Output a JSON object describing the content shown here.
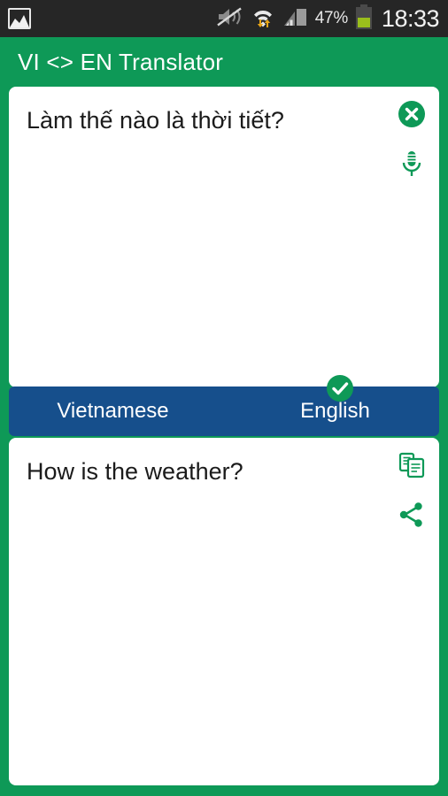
{
  "statusbar": {
    "notification_icon": "gallery-icon",
    "sound_icon": "mute-vibrate-icon",
    "wifi_icon": "wifi-transfer-icon",
    "signal_icon": "cellular-signal-icon",
    "battery_percent": "47%",
    "battery_icon": "battery-icon",
    "time": "18:33",
    "bg_color": "#262626"
  },
  "appbar": {
    "title": "VI <> EN Translator",
    "bg_color": "#0E9957"
  },
  "source_card": {
    "text": "Làm thế nào là thời tiết?",
    "clear_icon": "clear-circle-icon",
    "mic_icon": "microphone-icon"
  },
  "language_bar": {
    "source_language": "Vietnamese",
    "target_language": "English",
    "selected": "English",
    "check_icon": "check-circle-icon",
    "bg_color": "#164F8C"
  },
  "target_card": {
    "text": "How is the weather?",
    "copy_icon": "copy-icon",
    "share_icon": "share-icon"
  },
  "theme": {
    "green": "#0E9957",
    "blue": "#164F8C",
    "card_bg": "#ffffff",
    "text_color": "#1b1b1b"
  }
}
